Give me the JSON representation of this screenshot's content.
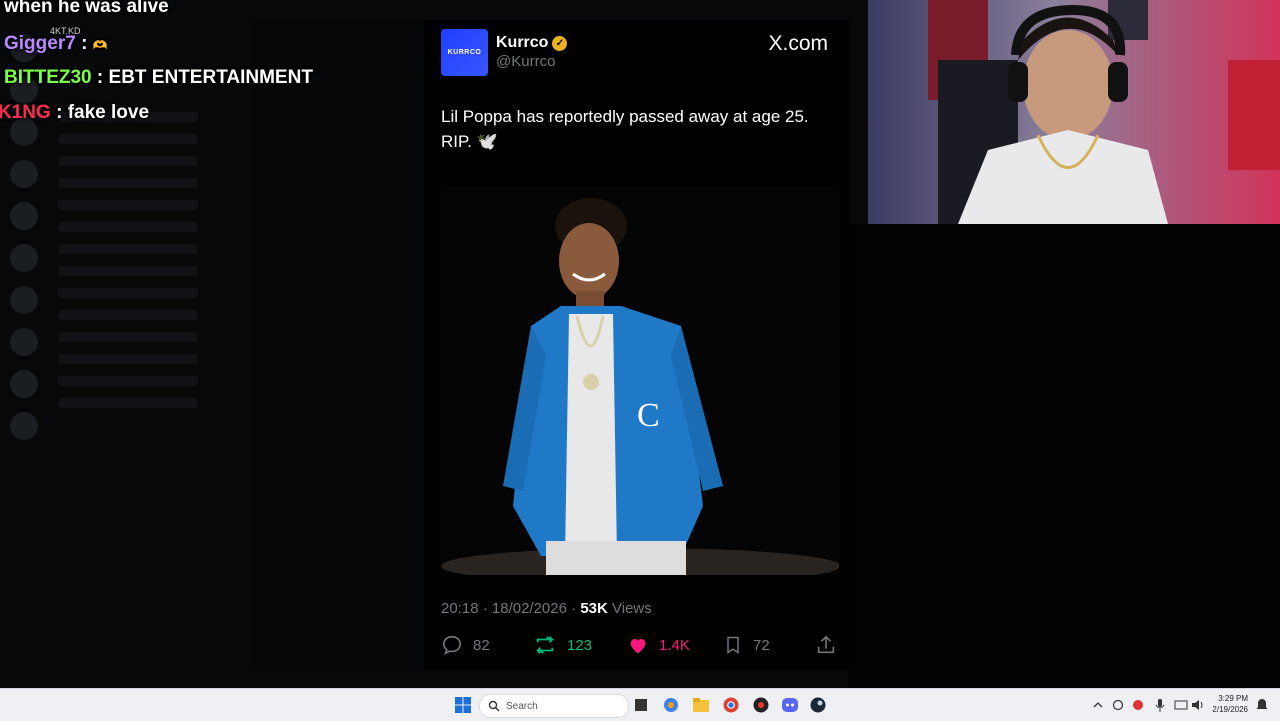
{
  "overlay": {
    "top_text": "when he was alive",
    "messages": [
      {
        "user": "Gigger7",
        "sep": " : ",
        "text": "",
        "color": "#b889ff"
      },
      {
        "user": "BITTEZ30",
        "sep": " : ",
        "text": "EBT ENTERTAINMENT",
        "color": "#7dff4a"
      },
      {
        "user": "K1NG",
        "sep": " : ",
        "text": "fake love",
        "color": "#ff2a4d"
      }
    ],
    "badge": "4KT.KD"
  },
  "tweet": {
    "display_name": "Kurrco",
    "handle": "@Kurrco",
    "site": "X.com",
    "text": "Lil Poppa has reportedly passed away at age 25. RIP. 🕊️",
    "time": "20:18",
    "date": "18/02/2026",
    "views_count": "53K",
    "views_label": "Views",
    "replies": "82",
    "reposts": "123",
    "likes": "1.4K",
    "bookmarks": "72"
  },
  "taskbar": {
    "search_placeholder": "Search",
    "time": "3:29 PM",
    "date": "2/19/2026"
  }
}
